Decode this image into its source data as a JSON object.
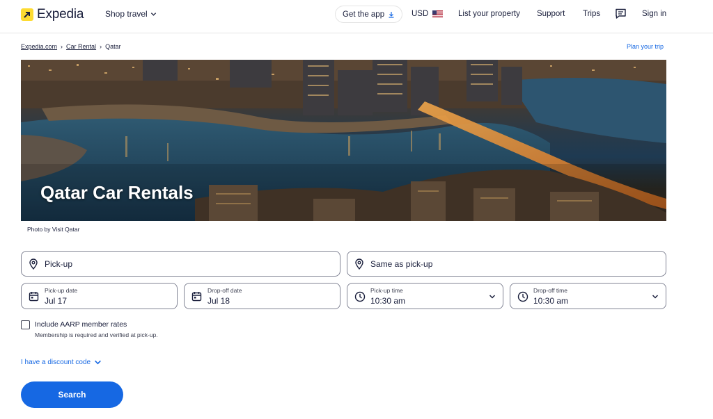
{
  "header": {
    "brand": "Expedia",
    "shop_travel": "Shop travel",
    "get_app": "Get the app",
    "currency": "USD",
    "list_property": "List your property",
    "support": "Support",
    "trips": "Trips",
    "sign_in": "Sign in"
  },
  "breadcrumb": {
    "items": [
      "Expedia.com",
      "Car Rental",
      "Qatar"
    ],
    "plan_trip": "Plan your trip"
  },
  "hero": {
    "title": "Qatar Car Rentals",
    "photo_credit": "Photo by Visit Qatar"
  },
  "form": {
    "pickup_placeholder": "Pick-up",
    "dropoff_placeholder": "Same as pick-up",
    "pickup_date_label": "Pick-up date",
    "pickup_date_value": "Jul 17",
    "dropoff_date_label": "Drop-off date",
    "dropoff_date_value": "Jul 18",
    "pickup_time_label": "Pick-up time",
    "pickup_time_value": "10:30 am",
    "dropoff_time_label": "Drop-off time",
    "dropoff_time_value": "10:30 am",
    "aarp_label": "Include AARP member rates",
    "aarp_note": "Membership is required and verified at pick-up.",
    "discount_link": "I have a discount code",
    "search_button": "Search"
  },
  "icons": {
    "logo": "expedia-logo-icon",
    "chevron": "chevron-down-icon",
    "download": "download-icon",
    "flag": "us-flag-icon",
    "messages": "message-icon",
    "location": "location-pin-icon",
    "calendar": "calendar-icon",
    "clock": "clock-icon"
  },
  "colors": {
    "brand_yellow": "#fddb32",
    "primary_blue": "#1668e3",
    "text_dark": "#191e3b"
  }
}
